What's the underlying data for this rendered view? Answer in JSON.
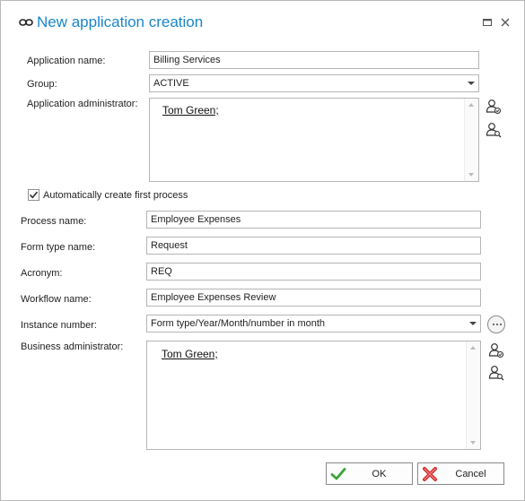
{
  "window": {
    "title": "New application creation",
    "icon": "link-icon"
  },
  "form": {
    "application_name": {
      "label": "Application name:",
      "value": "Billing Services"
    },
    "group": {
      "label": "Group:",
      "value": "ACTIVE"
    },
    "application_administrator": {
      "label": "Application administrator:",
      "value": "Tom Green;"
    },
    "auto_create_first_process": {
      "label": "Automatically create first process",
      "checked": true
    },
    "process_name": {
      "label": "Process name:",
      "value": "Employee Expenses"
    },
    "form_type_name": {
      "label": "Form type name:",
      "value": "Request"
    },
    "acronym": {
      "label": "Acronym:",
      "value": "REQ"
    },
    "workflow_name": {
      "label": "Workflow name:",
      "value": "Employee Expenses Review"
    },
    "instance_number": {
      "label": "Instance number:",
      "value": "Form type/Year/Month/number in month"
    },
    "business_administrator": {
      "label": "Business administrator:",
      "value": "Tom Green;"
    }
  },
  "buttons": {
    "ok": "OK",
    "cancel": "Cancel"
  },
  "colors": {
    "title": "#1a86c8",
    "ok_check": "#3aa33a",
    "cancel_x": "#d22c2c"
  }
}
